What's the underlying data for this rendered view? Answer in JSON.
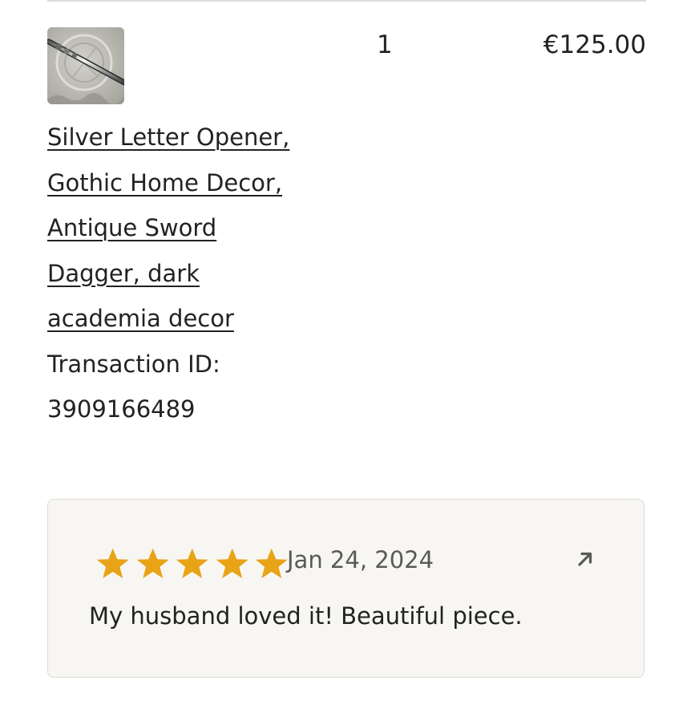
{
  "colors": {
    "text": "#222222",
    "muted_text": "#595959",
    "star": "#e8a317",
    "card_background": "#f7f6f2",
    "card_border": "#dedbd3"
  },
  "order_item": {
    "thumbnail_icon": "letter-opener-photo",
    "quantity": "1",
    "price": "€125.00",
    "title_lines": [
      "Silver Letter Opener,",
      "Gothic Home Decor,",
      "Antique Sword",
      "Dagger, dark",
      "academia decor"
    ],
    "transaction_label": "Transaction ID:",
    "transaction_id": "3909166489"
  },
  "review": {
    "rating": 5,
    "rating_max": 5,
    "date": "Jan 24, 2024",
    "text": "My husband loved it! Beautiful piece.",
    "open_icon": "arrow-up-right-icon"
  }
}
